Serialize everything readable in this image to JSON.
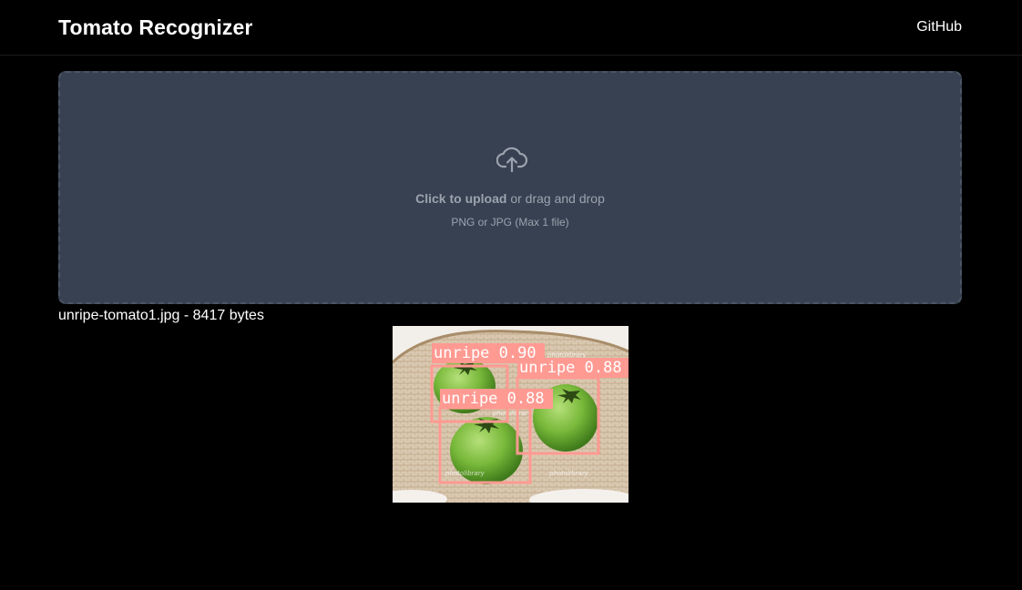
{
  "header": {
    "title": "Tomato Recognizer",
    "github_label": "GitHub"
  },
  "upload": {
    "icon": "cloud-upload-icon",
    "click_label": "Click to upload",
    "drag_label": "or drag and drop",
    "hint": "PNG or JPG (Max 1 file)"
  },
  "file": {
    "name": "unripe-tomato1.jpg",
    "separator": "-",
    "size": "8417 bytes"
  },
  "result": {
    "box_color": "#ff9a92",
    "detections": [
      {
        "label": "unripe",
        "score": "0.90"
      },
      {
        "label": "unripe",
        "score": "0.88"
      },
      {
        "label": "unripe",
        "score": "0.88"
      }
    ],
    "watermarks": [
      "photolibrary",
      "photolibrary",
      "photolibrary",
      "photolibrary"
    ]
  },
  "colors": {
    "background": "#000000",
    "dropzone": "#374151",
    "dropzone_border": "#4b5563",
    "muted_text": "#9ca3af"
  }
}
